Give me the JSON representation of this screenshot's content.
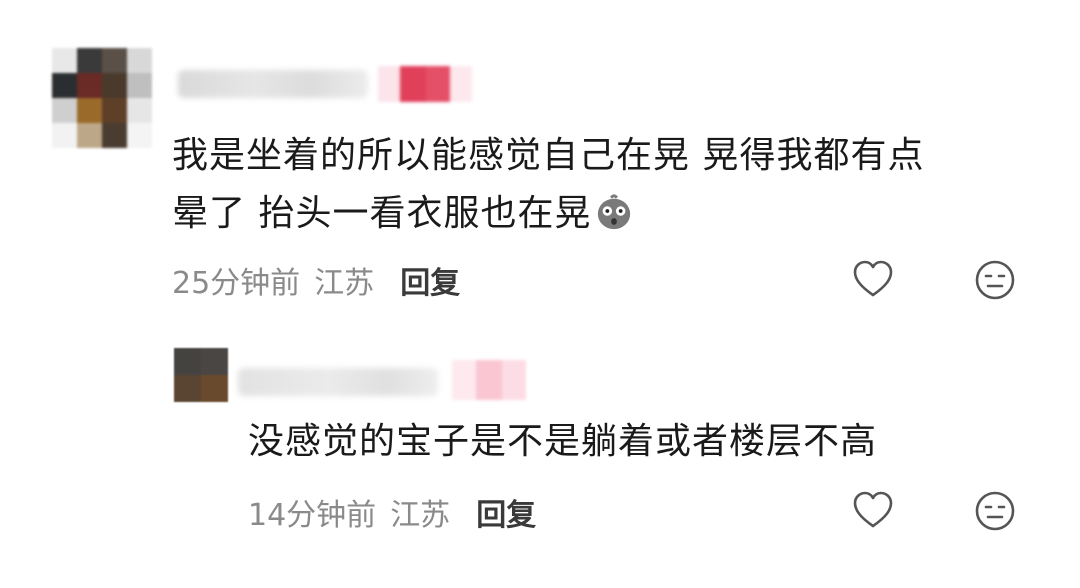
{
  "comments": [
    {
      "text_line1": "我是坐着的所以能感觉自己在晃 晃得我都有点",
      "text_line2": "晕了 抬头一看衣服也在晃",
      "emoji": "shocked-face-emoji",
      "time": "25分钟前",
      "location": "江苏",
      "reply_label": "回复",
      "like_icon": "heart-outline-icon",
      "dislike_icon": "neutral-face-icon"
    },
    {
      "text": "没感觉的宝子是不是躺着或者楼层不高",
      "time": "14分钟前",
      "location": "江苏",
      "reply_label": "回复",
      "like_icon": "heart-outline-icon",
      "dislike_icon": "neutral-face-icon"
    }
  ],
  "colors": {
    "text": "#1a1a1a",
    "meta": "#8a8a8a",
    "reply": "#3a3a3a",
    "icon": "#555555",
    "badge": "#e0405a"
  }
}
